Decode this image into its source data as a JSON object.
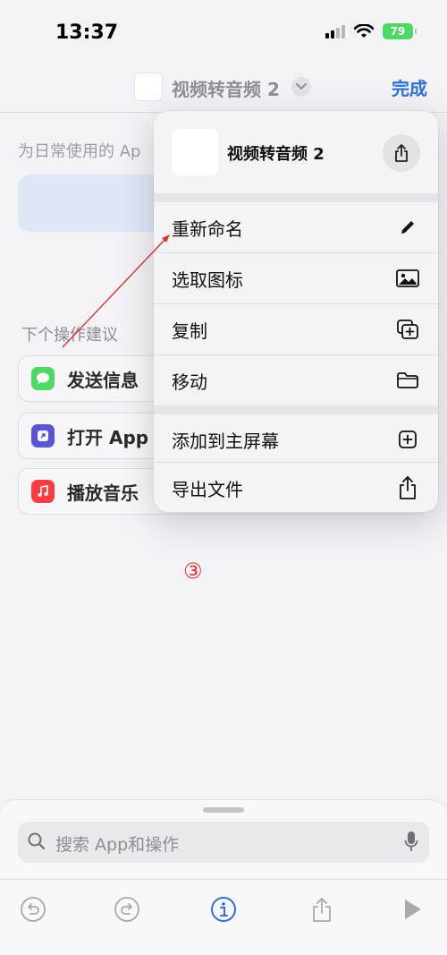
{
  "status_bar": {
    "time": "13:37",
    "battery": "79"
  },
  "navbar": {
    "title": "视频转音频 2",
    "done_label": "完成"
  },
  "background": {
    "description": "为日常使用的 Ap",
    "suggestions_header": "下个操作建议",
    "suggestions": [
      {
        "label": "发送信息",
        "icon": "messages-icon",
        "color": "#4cd964"
      },
      {
        "label": "打开 App",
        "icon": "open-app-icon",
        "color": "#5856d6"
      },
      {
        "label": "播放音乐",
        "icon": "music-icon",
        "color": "#fc3c44"
      }
    ]
  },
  "popup": {
    "title": "视频转音频 2",
    "items": [
      {
        "label": "重新命名",
        "icon": "pencil-icon"
      },
      {
        "label": "选取图标",
        "icon": "photo-icon"
      },
      {
        "label": "复制",
        "icon": "duplicate-icon"
      },
      {
        "label": "移动",
        "icon": "folder-icon"
      },
      {
        "label": "添加到主屏幕",
        "icon": "add-square-icon"
      },
      {
        "label": "导出文件",
        "icon": "export-icon"
      }
    ]
  },
  "annotation": {
    "step": "③",
    "color": "#e0302c"
  },
  "bottom_sheet": {
    "search_placeholder": "搜索 App和操作"
  },
  "colors": {
    "accent": "#2f6fd9"
  }
}
